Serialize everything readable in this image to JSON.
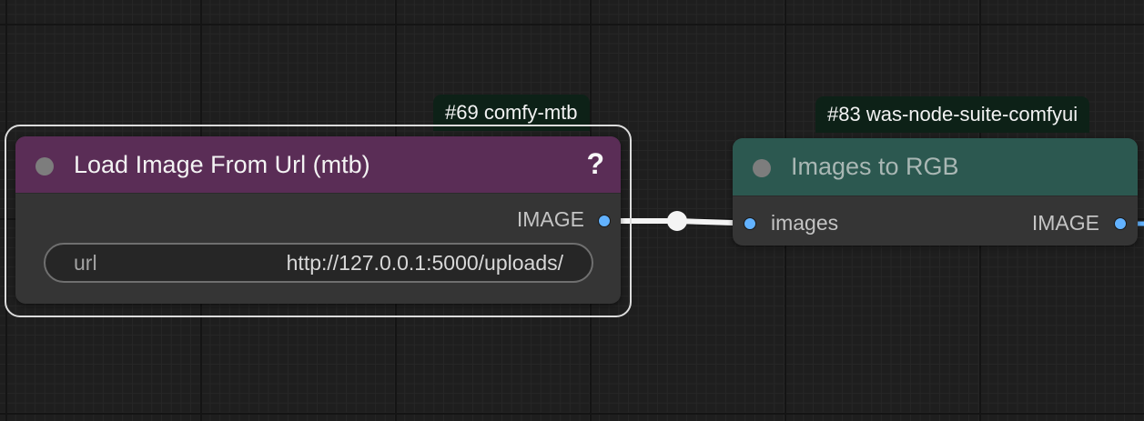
{
  "canvas": {
    "nodes": [
      {
        "id_badge": "#69 comfy-mtb",
        "title": "Load Image From Url (mtb)",
        "help_glyph": "?",
        "title_color": "#5a2d56",
        "outputs": [
          "IMAGE"
        ],
        "widgets": [
          {
            "label": "url",
            "value": "http://127.0.0.1:5000/uploads/"
          }
        ]
      },
      {
        "id_badge": "#83 was-node-suite-comfyui",
        "title": "Images to RGB",
        "title_color": "#2c5850",
        "inputs": [
          "images"
        ],
        "outputs": [
          "IMAGE"
        ]
      }
    ],
    "slot_color": "#62b2ff",
    "link_color": "#f4f4f4"
  }
}
